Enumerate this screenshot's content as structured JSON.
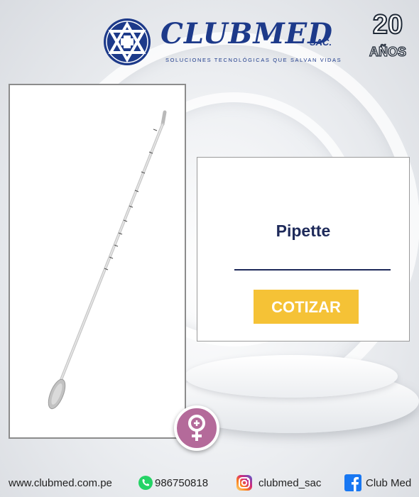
{
  "brand": {
    "name": "CLUBMED",
    "suffix": "SAC.",
    "tagline": "SOLUCIONES TECNOLÓGICAS QUE SALVAN VIDAS",
    "primary_color": "#1d3a8a"
  },
  "anniversary": {
    "number": "20",
    "label": "AÑOS"
  },
  "product": {
    "title": "Pipette",
    "image_icon": "pipette-image",
    "quote_label": "COTIZAR",
    "quote_color": "#f5c236"
  },
  "category": {
    "icon": "female-symbol-icon",
    "color": "#b46a9a"
  },
  "footer": {
    "website": "www.clubmed.com.pe",
    "whatsapp": "986750818",
    "instagram": "clubmed_sac",
    "facebook": "Club Med"
  }
}
